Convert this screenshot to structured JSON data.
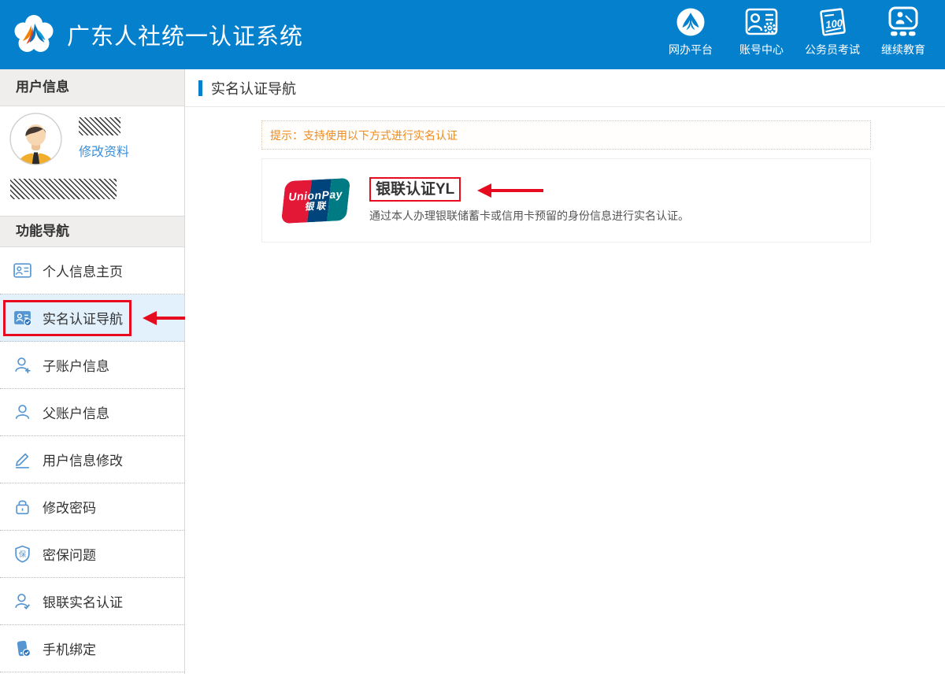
{
  "header": {
    "title": "广东人社统一认证系统",
    "logo_icon": "kapok-flower-logo",
    "nav": [
      {
        "name": "online-platform",
        "label": "网办平台",
        "icon": "portal-globe-icon"
      },
      {
        "name": "account-center",
        "label": "账号中心",
        "icon": "account-card-gear-icon"
      },
      {
        "name": "civil-service-exam",
        "label": "公务员考试",
        "icon": "exam-score-icon"
      },
      {
        "name": "continuing-education",
        "label": "继续教育",
        "icon": "teaching-board-icon"
      }
    ]
  },
  "sidebar": {
    "user_section": {
      "title": "用户信息",
      "avatar": "male-avatar",
      "username_redacted": true,
      "id_redacted": true,
      "edit_profile_link": "修改资料"
    },
    "nav_section": {
      "title": "功能导航",
      "items": [
        {
          "name": "personal-info-home",
          "label": "个人信息主页",
          "icon": "id-badge-icon",
          "active": false,
          "annotated": false
        },
        {
          "name": "realname-auth-nav",
          "label": "实名认证导航",
          "icon": "id-card-check-icon",
          "active": true,
          "annotated": true
        },
        {
          "name": "sub-account-info",
          "label": "子账户信息",
          "icon": "user-plus-icon",
          "active": false,
          "annotated": false
        },
        {
          "name": "parent-account-info",
          "label": "父账户信息",
          "icon": "user-icon",
          "active": false,
          "annotated": false
        },
        {
          "name": "user-info-edit",
          "label": "用户信息修改",
          "icon": "pencil-icon",
          "active": false,
          "annotated": false
        },
        {
          "name": "change-password",
          "label": "修改密码",
          "icon": "lock-icon",
          "active": false,
          "annotated": false
        },
        {
          "name": "security-question",
          "label": "密保问题",
          "icon": "shield-bao-icon",
          "active": false,
          "annotated": false
        },
        {
          "name": "unionpay-realname-auth",
          "label": "银联实名认证",
          "icon": "user-check-icon",
          "active": false,
          "annotated": false
        },
        {
          "name": "phone-binding",
          "label": "手机绑定",
          "icon": "phone-check-icon",
          "active": false,
          "annotated": false
        }
      ]
    }
  },
  "main": {
    "page_title": "实名认证导航",
    "notice": "提示：支持使用以下方式进行实名认证",
    "method": {
      "title": "银联认证YL",
      "description": "通过本人办理银联储蓄卡或信用卡预留的身份信息进行实名认证。",
      "annotated": true,
      "logo": {
        "line1": "UnionPay",
        "line2": "银联"
      }
    }
  },
  "colors": {
    "header_blue": "#0580cd",
    "annotation_red": "#e60b1e",
    "notice_orange": "#ee8a1d",
    "link_blue": "#3a90d9",
    "icon_blue": "#5596d2",
    "active_item_bg": "#e2f1fb",
    "unionpay_red": "#e21836",
    "unionpay_navy": "#00447c",
    "unionpay_teal": "#007b84"
  }
}
